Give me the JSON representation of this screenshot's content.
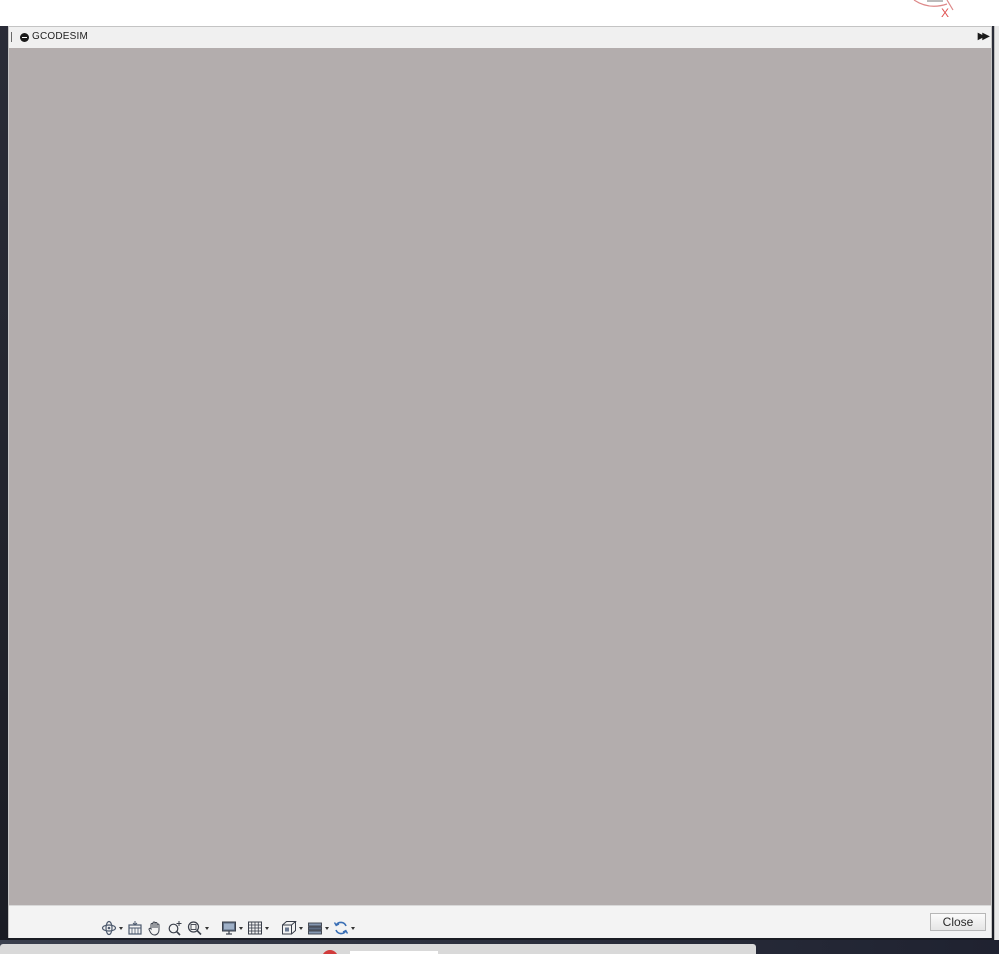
{
  "window": {
    "title": "GCODESIM",
    "axis_label": "X"
  },
  "icons": {
    "collapse": "collapse-circle-icon",
    "expand": "double-chevron-right-icon",
    "orbit": "orbit-icon",
    "look_at": "look-at-icon",
    "pan": "pan-hand-icon",
    "zoom": "zoom-in-icon",
    "zoom_window": "zoom-window-icon",
    "display_settings": "display-settings-icon",
    "grid": "grid-icon",
    "view_cube": "view-cube-icon",
    "layers": "layers-icon",
    "refresh": "refresh-icon"
  },
  "footer": {
    "close_label": "Close"
  },
  "colors": {
    "viewport_bg": "#b3adad",
    "axis_x": "#e05252"
  }
}
